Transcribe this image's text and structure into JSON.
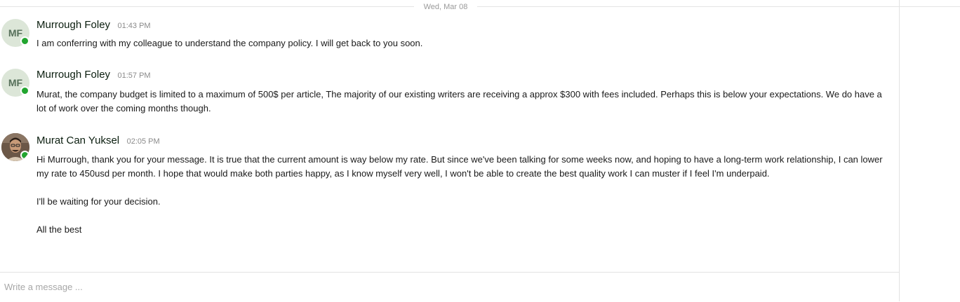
{
  "date_divider": "Wed, Mar 08",
  "colors": {
    "online": "#22a52f",
    "avatar_bg": "#dce6d8",
    "avatar_text": "#56705a"
  },
  "messages": [
    {
      "author": "Murrough Foley",
      "initials": "MF",
      "time": "01:43 PM",
      "status": "online",
      "paragraphs": [
        "I am conferring with my colleague to understand the company policy. I will get back to you soon."
      ]
    },
    {
      "author": "Murrough Foley",
      "initials": "MF",
      "time": "01:57 PM",
      "status": "online",
      "paragraphs": [
        "Murat, the company budget is limited to a maximum of 500$ per article, The majority of our existing writers are receiving a approx $300 with fees included. Perhaps this is below your expectations. We do have a lot of work over the coming months though."
      ]
    },
    {
      "author": "Murat Can Yuksel",
      "avatar": "profile-photo",
      "time": "02:05 PM",
      "status": "online",
      "paragraphs": [
        "Hi Murrough, thank you for your message. It is true that the current amount is way below my rate. But since we've been talking for some weeks now, and hoping to have a long-term work relationship, I can lower my rate to 450usd per month. I hope that would make both parties happy, as I know myself very well, I won't be able to create the best quality work I can muster if I feel I'm underpaid.",
        "I'll be waiting for your decision.",
        "All the best"
      ]
    }
  ],
  "composer": {
    "placeholder": "Write a message ..."
  }
}
